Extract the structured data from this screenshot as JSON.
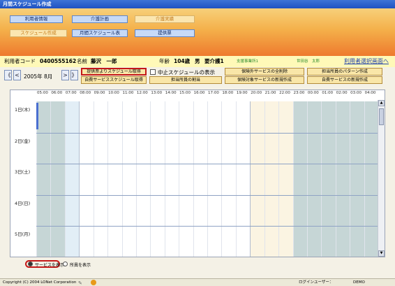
{
  "window": {
    "title": "月間スケジュール作成"
  },
  "tabs_row1": [
    {
      "label": "利用者情報",
      "active": false
    },
    {
      "label": "介護計画",
      "active": false
    },
    {
      "label": "介護実績",
      "active": true
    }
  ],
  "tabs_row2": [
    {
      "label": "スケジュール作成",
      "active": true
    },
    {
      "label": "月間スケジュール表",
      "active": false
    },
    {
      "label": "提供票",
      "active": false
    }
  ],
  "user_info": {
    "code_label": "利用者コード",
    "code_value": "0400555162",
    "name_label": "名前",
    "name_value": "藤沢　一郎",
    "age_label": "年齢",
    "age_value": "104歳",
    "gender": "男",
    "care_level": "要介護1",
    "office": "支援事業所1",
    "manager": "世田谷　太郎",
    "select_screen_link": "利用者選択画面へ"
  },
  "date_nav": {
    "first_label": "《",
    "prev_label": "<",
    "month_text": "2005年 8月",
    "next_label": ">",
    "last_label": "》"
  },
  "action_buttons": {
    "get_from_ticket": "提供票よりスケジュール取得",
    "get_self_service": "自費サービススケジュール取得",
    "show_cancelled": "中止スケジュールの表示",
    "assign_staff": "担当所員の割当",
    "delete_all_insurance": "保険外サービスの全削除",
    "new_insurance_service": "保険対象サービスの新規作成",
    "staff_pattern": "担当所員のパターン作成",
    "new_self_service": "自費サービスの新規作成"
  },
  "schedule": {
    "hours": [
      "05:00",
      "06:00",
      "07:00",
      "08:00",
      "09:00",
      "10:00",
      "11:00",
      "12:00",
      "13:00",
      "14:00",
      "15:00",
      "16:00",
      "17:00",
      "18:00",
      "19:00",
      "20:00",
      "21:00",
      "22:00",
      "23:00",
      "00:00",
      "01:00",
      "02:00",
      "03:00",
      "04:00"
    ],
    "days": [
      "1日(木)",
      "2日(金)",
      "3日(土)",
      "4日(日)",
      "5日(月)"
    ],
    "colors": {
      "night": "#c6d6d6",
      "morning": "#e2eef6",
      "day": "#ffffff",
      "evening": "#fbf4e2"
    }
  },
  "display_mode": {
    "service_label": "サービスを表示",
    "staff_label": "所員を表示",
    "selected": "service"
  },
  "status_bar": {
    "copyright": "Copyright (C) 2004 LONet Corporation",
    "login_label": "ログインユーザー：",
    "login_user": "DEMO"
  }
}
